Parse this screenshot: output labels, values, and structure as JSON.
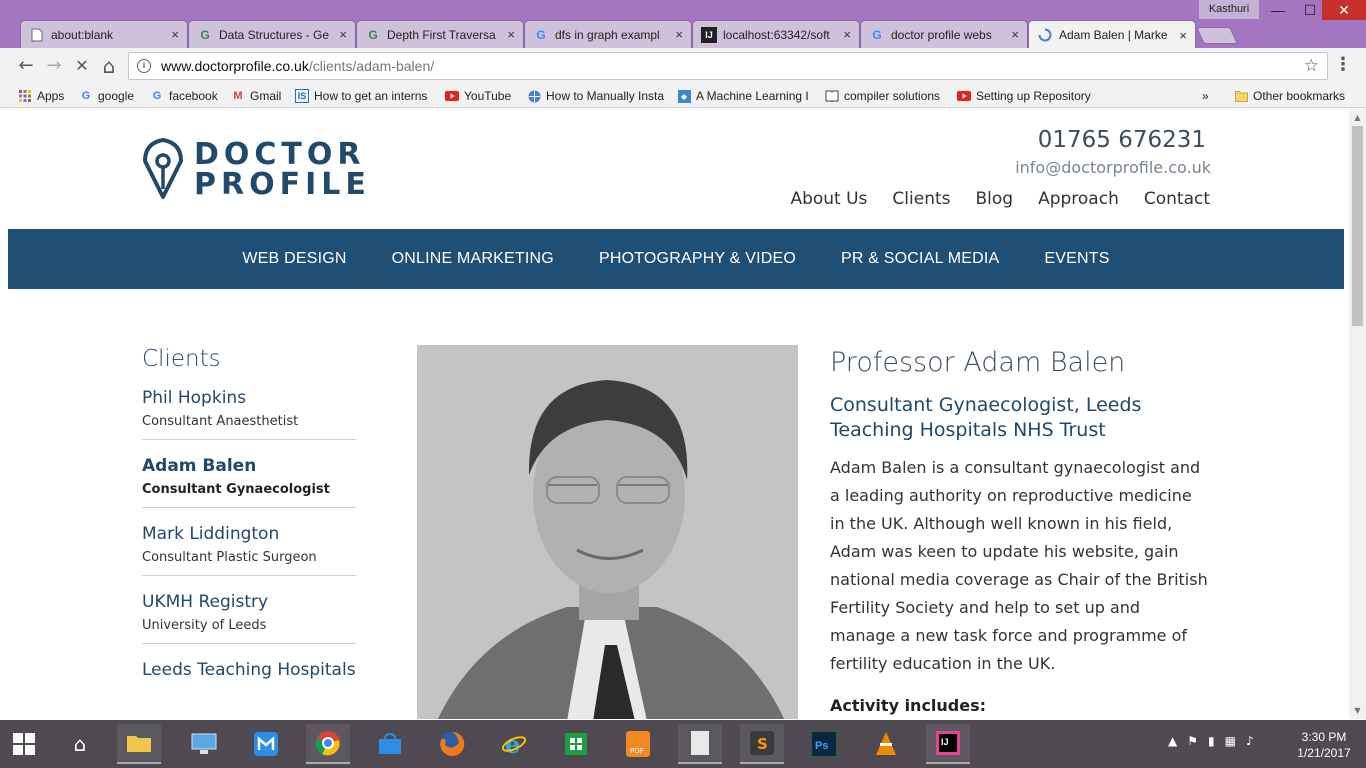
{
  "window": {
    "profile_name": "Kasthuri",
    "min_label": "—",
    "max_label": "☐",
    "close_label": "✕"
  },
  "tabs": [
    {
      "label": "about:blank",
      "icon": "page-icon"
    },
    {
      "label": "Data Structures - Ge",
      "icon": "geeksforgeeks-icon"
    },
    {
      "label": "Depth First Traversa",
      "icon": "geeksforgeeks-icon"
    },
    {
      "label": "dfs in graph exampl",
      "icon": "google-icon"
    },
    {
      "label": "localhost:63342/soft",
      "icon": "intellij-icon"
    },
    {
      "label": "doctor profile webs",
      "icon": "google-icon"
    },
    {
      "label": "Adam Balen | Marke",
      "icon": "loading-spinner-icon"
    }
  ],
  "tab_close": "×",
  "address_bar": {
    "host": "www.doctorprofile.co.uk",
    "path": "/clients/adam-balen/"
  },
  "nav_buttons": {
    "back": "←",
    "forward": "→",
    "stop": "✕",
    "home": "⌂",
    "star": "☆",
    "menu": "⋮"
  },
  "bookmarks": [
    {
      "label": "Apps",
      "icon": "apps-grid-icon"
    },
    {
      "label": "google",
      "icon": "google-icon"
    },
    {
      "label": "facebook",
      "icon": "google-icon"
    },
    {
      "label": "Gmail",
      "icon": "gmail-icon"
    },
    {
      "label": "How to get an interns",
      "icon": "internshala-icon"
    },
    {
      "label": "YouTube",
      "icon": "youtube-icon"
    },
    {
      "label": "How to Manually Insta",
      "icon": "globe-icon"
    },
    {
      "label": "A Machine Learning I",
      "icon": "bookmark-blue-icon"
    },
    {
      "label": "compiler solutions",
      "icon": "book-icon"
    },
    {
      "label": "Setting up Repository",
      "icon": "youtube-icon"
    }
  ],
  "bookmarks_overflow": "»",
  "other_bookmarks": "Other bookmarks",
  "site": {
    "logo_line1": "DOCTOR",
    "logo_line2": "PROFILE",
    "phone": "01765 676231",
    "email": "info@doctorprofile.co.uk",
    "top_nav": [
      "About Us",
      "Clients",
      "Blog",
      "Approach",
      "Contact"
    ],
    "main_nav": [
      "WEB DESIGN",
      "ONLINE MARKETING",
      "PHOTOGRAPHY & VIDEO",
      "PR & SOCIAL MEDIA",
      "EVENTS"
    ],
    "sidebar_title": "Clients",
    "clients": [
      {
        "name": "Phil Hopkins",
        "role": "Consultant Anaesthetist"
      },
      {
        "name": "Adam Balen",
        "role": "Consultant Gynaecologist"
      },
      {
        "name": "Mark Liddington",
        "role": "Consultant Plastic Surgeon"
      },
      {
        "name": "UKMH Registry",
        "role": "University of Leeds"
      },
      {
        "name": "Leeds Teaching Hospitals",
        "role": ""
      }
    ],
    "profile": {
      "name": "Professor Adam Balen",
      "title": "Consultant Gynaecologist, Leeds Teaching Hospitals NHS Trust",
      "bio": "Adam Balen is a consultant gynaecologist and a leading authority on reproductive medicine in the UK. Although well known in his field, Adam was keen to update his website, gain national media coverage as Chair of the British Fertility Society and help to set up and manage a new task force and programme of fertility education in the UK.",
      "activity_heading": "Activity includes:"
    }
  },
  "taskbar": {
    "apps": [
      "start-windows-icon",
      "home-icon",
      "file-explorer-icon",
      "lenovo-icon",
      "this-pc-icon",
      "maxthon-icon",
      "chrome-icon",
      "store-bag-icon",
      "firefox-icon",
      "internet-explorer-icon",
      "windows-store-icon",
      "pdf-icon",
      "files-icon",
      "sublime-text-icon",
      "photoshop-icon",
      "vlc-icon",
      "intellij-icon"
    ],
    "time": "3:30 PM",
    "date": "1/21/2017"
  },
  "colors": {
    "brand_navy": "#1f4f75",
    "brand_text": "#21496b",
    "chrome_frame": "#a476c1"
  }
}
